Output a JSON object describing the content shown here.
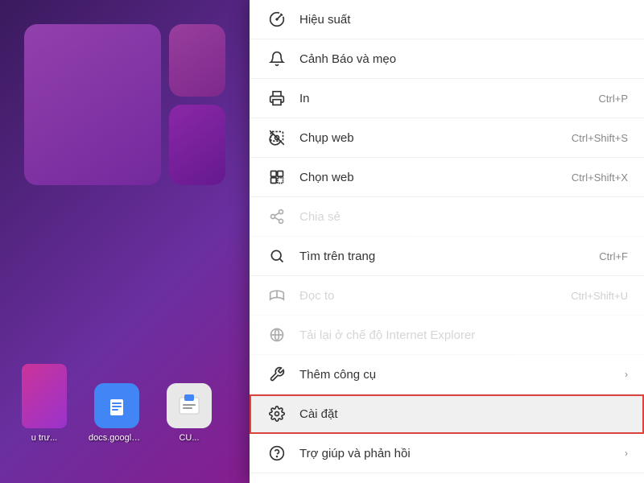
{
  "desktop": {
    "icons": [
      {
        "label": "u trư...",
        "type": "purple-rect",
        "icon": ""
      },
      {
        "label": "docs.google....",
        "type": "blue",
        "icon": "📄"
      },
      {
        "label": "CU...",
        "type": "text",
        "icon": "📋"
      }
    ]
  },
  "contextMenu": {
    "items": [
      {
        "id": "hieu-suat",
        "label": "Hiệu suất",
        "shortcut": "",
        "hasArrow": false,
        "disabled": false,
        "icon": "hieu-suat-icon"
      },
      {
        "id": "canh-bao",
        "label": "Cảnh Báo và mẹo",
        "shortcut": "",
        "hasArrow": false,
        "disabled": false,
        "icon": "bell-icon"
      },
      {
        "id": "in",
        "label": "In",
        "shortcut": "Ctrl+P",
        "hasArrow": false,
        "disabled": false,
        "icon": "print-icon"
      },
      {
        "id": "chup-web",
        "label": "Chụp web",
        "shortcut": "Ctrl+Shift+S",
        "hasArrow": false,
        "disabled": false,
        "icon": "screenshot-icon"
      },
      {
        "id": "chon-web",
        "label": "Chọn web",
        "shortcut": "Ctrl+Shift+X",
        "hasArrow": false,
        "disabled": false,
        "icon": "select-icon"
      },
      {
        "id": "chia-se",
        "label": "Chia sẻ",
        "shortcut": "",
        "hasArrow": false,
        "disabled": true,
        "icon": "share-icon"
      },
      {
        "id": "tim-trang",
        "label": "Tìm trên trang",
        "shortcut": "Ctrl+F",
        "hasArrow": false,
        "disabled": false,
        "icon": "search-icon"
      },
      {
        "id": "doc-to",
        "label": "Đọc to",
        "shortcut": "Ctrl+Shift+U",
        "hasArrow": false,
        "disabled": true,
        "icon": "read-icon"
      },
      {
        "id": "tai-lai-ie",
        "label": "Tải lại ở chế độ Internet Explorer",
        "shortcut": "",
        "hasArrow": false,
        "disabled": true,
        "icon": "ie-icon"
      },
      {
        "id": "them-cong-cu",
        "label": "Thêm công cụ",
        "shortcut": "",
        "hasArrow": true,
        "disabled": false,
        "icon": "tools-icon"
      },
      {
        "id": "cai-dat",
        "label": "Cài đặt",
        "shortcut": "",
        "hasArrow": false,
        "disabled": false,
        "icon": "settings-icon",
        "highlighted": true
      },
      {
        "id": "tro-giup",
        "label": "Trợ giúp và phản hồi",
        "shortcut": "",
        "hasArrow": true,
        "disabled": false,
        "icon": "help-icon"
      }
    ]
  }
}
